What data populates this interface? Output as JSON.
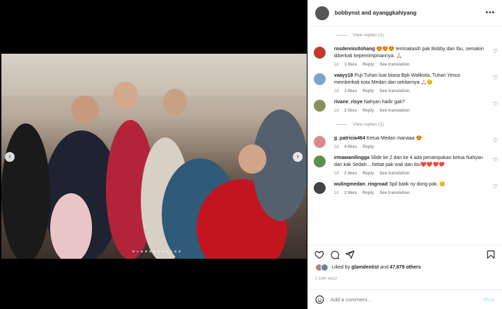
{
  "header": {
    "title": "bobbynst and ayanggkahiyang"
  },
  "comments": [
    {
      "type": "replies",
      "label": "View replies (1)"
    },
    {
      "type": "comment",
      "user": "rosdennisitohang",
      "text": "😍😍😍 terimakasih pak Bobby dan Ibu, semakin diberkati kepemimpinannya. 🙏🏻",
      "time": "1d",
      "likes": "3 likes",
      "reply": "Reply",
      "translate": "See translation",
      "avatar_color": "#c0392b"
    },
    {
      "type": "comment",
      "user": "vaayy18",
      "text": "Puji Tuhan luar biasa Bpk Walikota, Tuhan Yesus memberkati kota Medan dan sekitarnya 🙏🏻😊",
      "time": "1d",
      "likes": "3 likes",
      "reply": "Reply",
      "translate": "See translation",
      "avatar_color": "#7fa3c9"
    },
    {
      "type": "comment",
      "user": "rivane_risye",
      "text": "Nahyan hadir gak?",
      "time": "1d",
      "likes": "2 likes",
      "reply": "Reply",
      "translate": "See translation",
      "avatar_color": "#8a8f5a"
    },
    {
      "type": "replies",
      "label": "View replies (1)"
    },
    {
      "type": "comment",
      "user": "g_patricia464",
      "text": "Ketua Medan manaaa 😍",
      "time": "1d",
      "likes": "4 likes",
      "reply": "Reply",
      "translate": "",
      "avatar_color": "#d98b8b"
    },
    {
      "type": "comment",
      "user": "irmawanilingga",
      "text": "Slide ke 2 dan ke 4 ada penampakan ketua Nahyan dan kak Sedah....hebat pak wali dan ibu❤️❤️❤️❤️",
      "time": "1d",
      "likes": "2 likes",
      "reply": "Reply",
      "translate": "See translation",
      "avatar_color": "#5e8f4e"
    },
    {
      "type": "comment",
      "user": "wulingmedan_ringroad",
      "text": "Spil batik ny dong pak. 😊",
      "time": "1d",
      "likes": "2 likes",
      "reply": "Reply",
      "translate": "See translation",
      "avatar_color": "#444444"
    }
  ],
  "likes": {
    "prefix": "Liked by",
    "user": "glamdentist",
    "connector": "and",
    "count": "47,679 others"
  },
  "date": "1 DAY AGO",
  "add_comment": {
    "placeholder": "Add a comment...",
    "post": "Post"
  },
  "icons": {
    "heart": "heart-icon",
    "comment": "comment-icon",
    "share": "share-icon",
    "bookmark": "bookmark-icon",
    "emoji": "emoji-icon",
    "more": "more-icon"
  },
  "carousel": {
    "slides": 12,
    "active": 1
  }
}
